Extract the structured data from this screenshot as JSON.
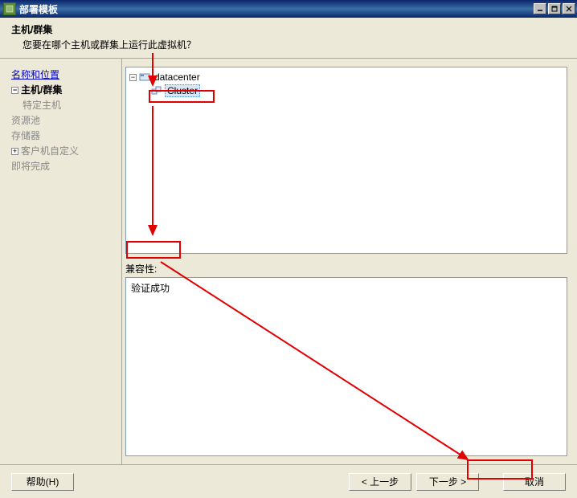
{
  "window": {
    "title": "部署模板"
  },
  "header": {
    "title": "主机/群集",
    "subtitle": "您要在哪个主机或群集上运行此虚拟机？"
  },
  "sidebar": {
    "items": [
      {
        "label": "名称和位置",
        "type": "link"
      },
      {
        "label": "主机/群集",
        "type": "active",
        "expandable": true
      },
      {
        "label": "特定主机",
        "type": "sub"
      },
      {
        "label": "资源池",
        "type": "inactive"
      },
      {
        "label": "存储器",
        "type": "inactive"
      },
      {
        "label": "客户机自定义",
        "type": "inactive",
        "expandable": true
      },
      {
        "label": "即将完成",
        "type": "inactive"
      }
    ]
  },
  "tree": {
    "root": {
      "label": "datacenter",
      "expanded": true
    },
    "child": {
      "label": "Cluster",
      "selected": true
    }
  },
  "compat": {
    "label": "兼容性:",
    "text": "验证成功"
  },
  "footer": {
    "help": "帮助(H)",
    "back": "< 上一步",
    "next": "下一步 >",
    "cancel": "取消"
  }
}
